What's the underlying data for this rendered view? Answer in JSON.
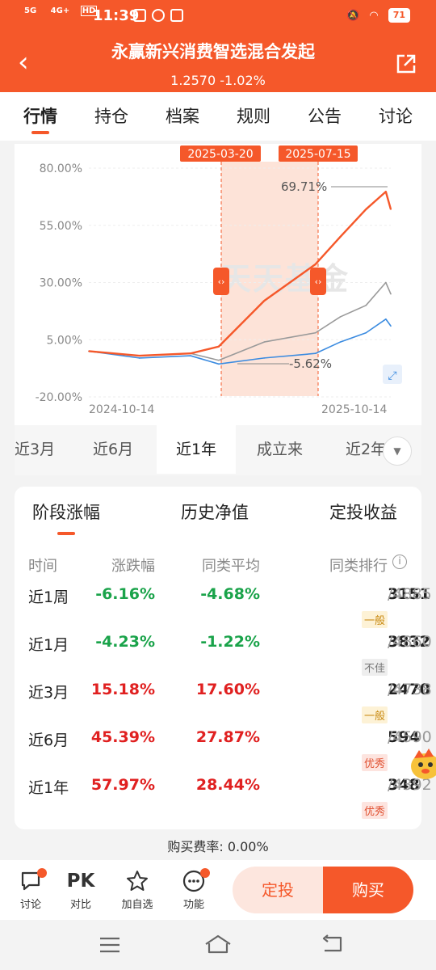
{
  "status_bar": {
    "network": "5G",
    "network2": "4G+",
    "hd": "HD",
    "time": "11:39",
    "battery": "71"
  },
  "header": {
    "title": "永赢新兴消费智选混合发起",
    "nav_value": "1.2570",
    "nav_change": "-1.02%"
  },
  "tabs": [
    "行情",
    "持仓",
    "档案",
    "规则",
    "公告",
    "讨论"
  ],
  "chart": {
    "highlight_start": "2025-03-20",
    "highlight_end": "2025-07-15",
    "y_ticks": [
      "80.00%",
      "55.00%",
      "30.00%",
      "5.00%",
      "-20.00%"
    ],
    "x_ticks": [
      "2024-10-14",
      "2025-10-14"
    ],
    "max_label": "69.71%",
    "min_label": "-5.62%",
    "watermark": "天天基金"
  },
  "chart_data": {
    "type": "line",
    "x": [
      "2024-10-14",
      "2024-12-14",
      "2025-02-14",
      "2025-03-20",
      "2025-05-14",
      "2025-07-15",
      "2025-08-14",
      "2025-09-14",
      "2025-10-08",
      "2025-10-14"
    ],
    "ylim": [
      -20,
      80
    ],
    "series": [
      {
        "values": [
          0,
          -2,
          -1,
          2,
          22,
          38,
          50,
          62,
          69.71,
          62
        ],
        "color": "#f5582a"
      },
      {
        "values": [
          0,
          -2,
          -1,
          -4,
          4,
          8,
          15,
          20,
          30,
          25
        ],
        "color": "#9a9a9a"
      },
      {
        "values": [
          0,
          -3,
          -2,
          -5.62,
          -3,
          -1,
          4,
          8,
          14,
          11
        ],
        "color": "#3b8be0"
      }
    ],
    "annotations": [
      "69.71%",
      "-5.62%"
    ]
  },
  "range_tabs": [
    "近3月",
    "近6月",
    "近1年",
    "成立来",
    "近2年"
  ],
  "perf": {
    "subtabs": [
      "阶段涨幅",
      "历史净值",
      "定投收益"
    ],
    "headers": [
      "时间",
      "涨跌幅",
      "同类平均",
      "同类排行"
    ],
    "rows": [
      {
        "period": "近1周",
        "change": "-6.16%",
        "avg": "-4.68%",
        "rank": "3151",
        "total": "/4885",
        "badge": "一般"
      },
      {
        "period": "近1月",
        "change": "-4.23%",
        "avg": "-1.22%",
        "rank": "3832",
        "total": "/4860",
        "badge": "不佳"
      },
      {
        "period": "近3月",
        "change": "15.18%",
        "avg": "17.60%",
        "rank": "2470",
        "total": "/4738",
        "badge": "一般"
      },
      {
        "period": "近6月",
        "change": "45.39%",
        "avg": "27.87%",
        "rank": "594",
        "total": "/4590",
        "badge": "优秀"
      },
      {
        "period": "近1年",
        "change": "57.97%",
        "avg": "28.44%",
        "rank": "348",
        "total": "/4392",
        "badge": "优秀"
      }
    ]
  },
  "fee": "购买费率: 0.00%",
  "bottom_bar": {
    "items": [
      "讨论",
      "对比",
      "加自选",
      "功能"
    ],
    "pk": "PK",
    "dingtou": "定投",
    "buy": "购买"
  },
  "colors": {
    "brand": "#f5582a",
    "up": "#e02020",
    "down": "#1aa34a"
  }
}
